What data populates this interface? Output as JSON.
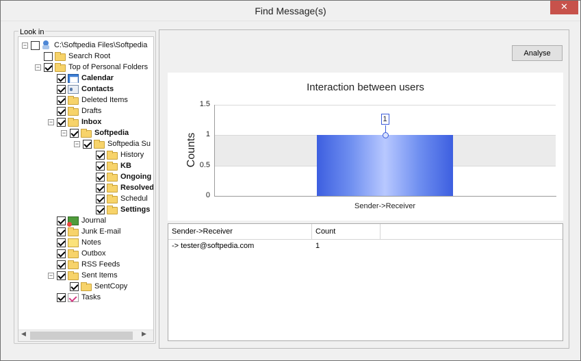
{
  "window": {
    "title": "Find Message(s)",
    "close_glyph": "✕"
  },
  "look_in": {
    "legend": "Look in"
  },
  "tree": [
    {
      "label": "C:\\Softpedia Files\\Softpedia",
      "bold": false,
      "checked": false,
      "level": 0,
      "expander": "−",
      "icon": "pst-icon"
    },
    {
      "label": "Search Root",
      "bold": false,
      "checked": false,
      "level": 1,
      "expander": "",
      "icon": "folder-icon"
    },
    {
      "label": "Top of Personal Folders",
      "bold": false,
      "checked": true,
      "level": 1,
      "expander": "−",
      "icon": "folder-icon"
    },
    {
      "label": "Calendar",
      "bold": true,
      "checked": true,
      "level": 2,
      "expander": "",
      "icon": "calendar-icon"
    },
    {
      "label": "Contacts",
      "bold": true,
      "checked": true,
      "level": 2,
      "expander": "",
      "icon": "contacts-icon"
    },
    {
      "label": "Deleted Items",
      "bold": false,
      "checked": true,
      "level": 2,
      "expander": "",
      "icon": "folder-icon"
    },
    {
      "label": "Drafts",
      "bold": false,
      "checked": true,
      "level": 2,
      "expander": "",
      "icon": "folder-icon"
    },
    {
      "label": "Inbox",
      "bold": true,
      "checked": true,
      "level": 2,
      "expander": "−",
      "icon": "folder-icon"
    },
    {
      "label": "Softpedia",
      "bold": true,
      "checked": true,
      "level": 3,
      "expander": "−",
      "icon": "folder-icon"
    },
    {
      "label": "Softpedia Su",
      "bold": false,
      "checked": true,
      "level": 4,
      "expander": "−",
      "icon": "folder-icon"
    },
    {
      "label": "History",
      "bold": false,
      "checked": true,
      "level": 5,
      "expander": "",
      "icon": "folder-icon"
    },
    {
      "label": "KB",
      "bold": true,
      "checked": true,
      "level": 5,
      "expander": "",
      "icon": "folder-icon"
    },
    {
      "label": "Ongoing",
      "bold": true,
      "checked": true,
      "level": 5,
      "expander": "",
      "icon": "folder-icon"
    },
    {
      "label": "Resolved",
      "bold": true,
      "checked": true,
      "level": 5,
      "expander": "",
      "icon": "folder-icon"
    },
    {
      "label": "Schedul",
      "bold": false,
      "checked": true,
      "level": 5,
      "expander": "",
      "icon": "folder-icon"
    },
    {
      "label": "Settings",
      "bold": true,
      "checked": true,
      "level": 5,
      "expander": "",
      "icon": "folder-icon"
    },
    {
      "label": "Journal",
      "bold": false,
      "checked": true,
      "level": 2,
      "expander": "",
      "icon": "journal-icon"
    },
    {
      "label": "Junk E-mail",
      "bold": false,
      "checked": true,
      "level": 2,
      "expander": "",
      "icon": "folder-icon"
    },
    {
      "label": "Notes",
      "bold": false,
      "checked": true,
      "level": 2,
      "expander": "",
      "icon": "notes-icon"
    },
    {
      "label": "Outbox",
      "bold": false,
      "checked": true,
      "level": 2,
      "expander": "",
      "icon": "folder-icon"
    },
    {
      "label": "RSS Feeds",
      "bold": false,
      "checked": true,
      "level": 2,
      "expander": "",
      "icon": "folder-icon"
    },
    {
      "label": "Sent Items",
      "bold": false,
      "checked": true,
      "level": 2,
      "expander": "−",
      "icon": "folder-icon"
    },
    {
      "label": "SentCopy",
      "bold": false,
      "checked": true,
      "level": 3,
      "expander": "",
      "icon": "folder-icon"
    },
    {
      "label": "Tasks",
      "bold": false,
      "checked": true,
      "level": 2,
      "expander": "",
      "icon": "tasks-icon"
    }
  ],
  "scroll": {
    "left_arrow": "◀",
    "right_arrow": "▶"
  },
  "analyse_button": "Analyse",
  "chart_data": {
    "type": "bar",
    "title": "Interaction between users",
    "ylabel": "Counts",
    "xlabel": "",
    "categories": [
      "Sender->Receiver"
    ],
    "values": [
      1
    ],
    "data_labels": [
      "1"
    ],
    "ylim": [
      0,
      1.5
    ],
    "yticks": [
      "0",
      "0.5",
      "1",
      "1.5"
    ],
    "grid": true,
    "bar_color": "#5a78e8"
  },
  "results_table": {
    "columns": [
      "Sender->Receiver",
      "Count"
    ],
    "rows": [
      [
        "-> tester@softpedia.com",
        "1"
      ]
    ]
  }
}
